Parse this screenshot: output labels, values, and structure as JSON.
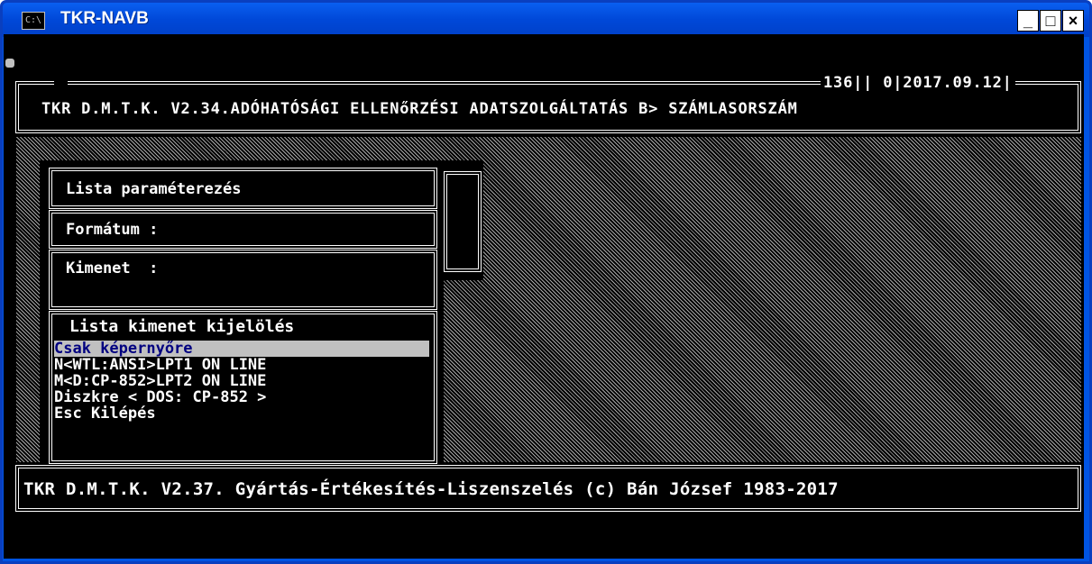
{
  "window": {
    "title": "TKR-NAVB",
    "icon_text": "C:\\",
    "minimize_label": "_",
    "maximize_label": "□",
    "close_label": "×"
  },
  "header": {
    "counter_a": "136",
    "counter_b": "0",
    "date": "2017.09.12",
    "title": "TKR D.M.T.K. V2.34.ADÓHATÓSÁGI ELLENőRZÉSI ADATSZOLGÁLTATÁS B> SZÁMLASORSZÁM"
  },
  "dialog": {
    "title": "Lista paraméterezés",
    "format_label": "Formátum :",
    "output_label": "Kimenet  :"
  },
  "menu": {
    "title": "Lista kimenet kijelölés",
    "items": [
      "Csak képernyőre",
      "N<WTL:ANSI>LPT1 ON LINE",
      "M<D:CP-852>LPT2 ON LINE",
      "Diszkre < DOS: CP-852 >",
      "Esc Kilépés"
    ]
  },
  "footer": {
    "text": "TKR D.M.T.K. V2.37. Gyártás-Értékesítés-Liszenszelés (c) Bán József 1983-2017"
  }
}
